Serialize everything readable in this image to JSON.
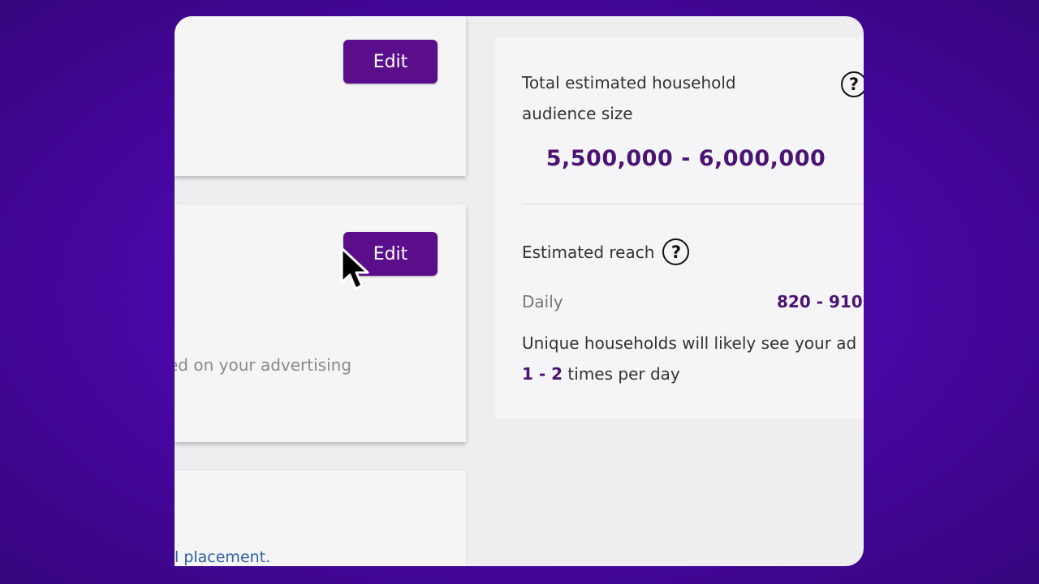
{
  "cards": {
    "card1": {
      "edit_label": "Edit"
    },
    "card2": {
      "edit_label": "Edit",
      "body_text": "ed on your advertising"
    },
    "card3": {
      "link_text": "l placement."
    }
  },
  "audience": {
    "total_label": "Total estimated household audience size",
    "total_range": "5,500,000 - 6,000,000",
    "help_icon": "question-circle-icon",
    "reach_label": "Estimated reach",
    "daily_label": "Daily",
    "daily_value": "820 - 910",
    "unique_prefix": "Unique households will likely see your ad ",
    "unique_freq": "1 - 2",
    "unique_suffix": " times per day"
  },
  "colors": {
    "brand_purple": "#5b0e8c",
    "value_purple": "#4b1373",
    "background": "#4a07a8"
  }
}
